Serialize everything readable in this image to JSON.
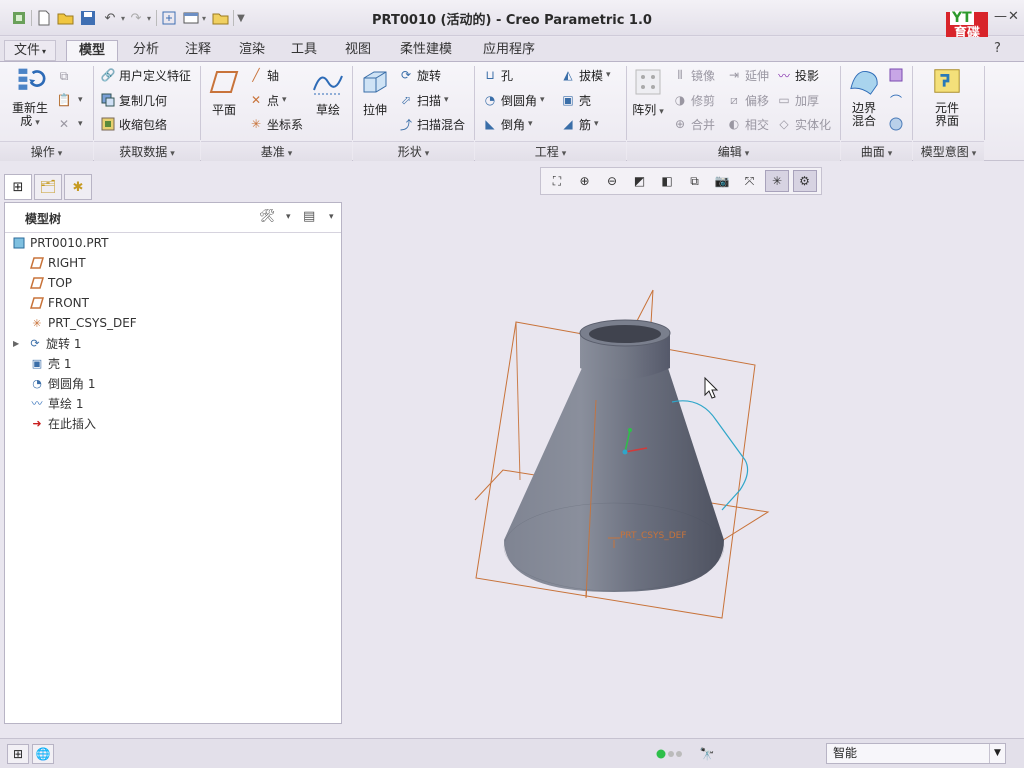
{
  "window": {
    "title": "PRT0010 (活动的) - Creo Parametric 1.0",
    "logo_text": "育碟\n软件",
    "logo_badge": "YT"
  },
  "tabs": [
    {
      "label": "文件",
      "has_dropdown": true
    },
    {
      "label": "模型",
      "active": true
    },
    {
      "label": "分析"
    },
    {
      "label": "注释"
    },
    {
      "label": "渲染"
    },
    {
      "label": "工具"
    },
    {
      "label": "视图"
    },
    {
      "label": "柔性建模"
    },
    {
      "label": "应用程序"
    }
  ],
  "ribbon": {
    "operations": {
      "group_label": "操作",
      "regenerate_label": "重新生\n成",
      "regenerate_short": "重新生",
      "regenerate_line2": "成"
    },
    "get_data": {
      "group_label": "获取数据",
      "items": [
        "用户定义特征",
        "复制几何",
        "收缩包络"
      ]
    },
    "datum": {
      "group_label": "基准",
      "plane": "平面",
      "items": [
        "轴",
        "点",
        "坐标系"
      ],
      "sketch": "草绘"
    },
    "shapes": {
      "group_label": "形状",
      "extrude": "拉伸",
      "items": [
        "旋转",
        "扫描",
        "扫描混合"
      ]
    },
    "engineering": {
      "group_label": "工程",
      "col1": [
        "孔",
        "倒圆角",
        "倒角"
      ],
      "col2": [
        "拔模",
        "壳",
        "筋"
      ]
    },
    "editing": {
      "group_label": "编辑",
      "pattern": "阵列",
      "col1": [
        "镜像",
        "修剪",
        "合并"
      ],
      "col2": [
        "延伸",
        "偏移",
        "相交"
      ],
      "col3": [
        "投影",
        "加厚",
        "实体化"
      ]
    },
    "surfaces": {
      "group_label": "曲面",
      "boundary_blend": "边界\n混合",
      "boundary_line1": "边界",
      "boundary_line2": "混合"
    },
    "model_intent": {
      "group_label": "模型意图",
      "component_line1": "元件",
      "component_line2": "界面"
    }
  },
  "left_panel": {
    "tree_label": "模型树",
    "nodes": [
      {
        "label": "PRT0010.PRT",
        "icon": "part-icon"
      },
      {
        "label": "RIGHT",
        "icon": "datum-plane-icon"
      },
      {
        "label": "TOP",
        "icon": "datum-plane-icon"
      },
      {
        "label": "FRONT",
        "icon": "datum-plane-icon"
      },
      {
        "label": "PRT_CSYS_DEF",
        "icon": "csys-icon"
      },
      {
        "label": "旋转 1",
        "icon": "revolve-icon",
        "expandable": true
      },
      {
        "label": "壳 1",
        "icon": "shell-icon"
      },
      {
        "label": "倒圆角 1",
        "icon": "round-icon"
      },
      {
        "label": "草绘 1",
        "icon": "sketch-icon"
      },
      {
        "label": "在此插入",
        "icon": "insert-arrow-icon"
      }
    ]
  },
  "graphics": {
    "csys_label": "PRT_CSYS_DEF"
  },
  "status_bar": {
    "filter_value": "智能"
  },
  "colors": {
    "datum_plane": "#c8733a",
    "model_body": "#6b7080",
    "sketch_curve": "#2fa6c9",
    "background": "#e9e6ef"
  }
}
